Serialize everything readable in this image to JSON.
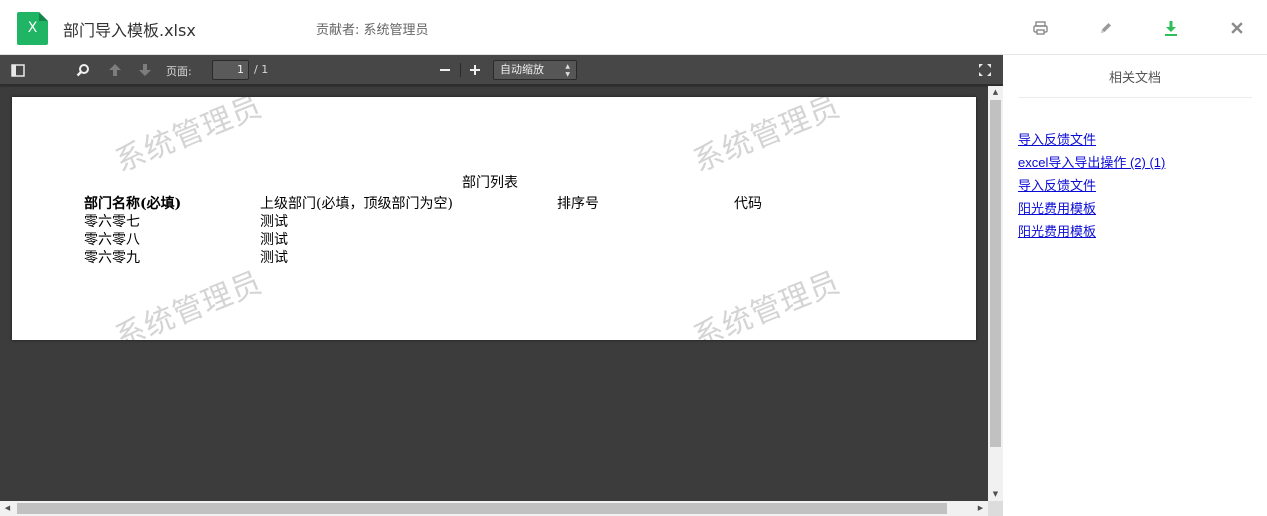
{
  "header": {
    "file_icon_letter": "X",
    "file_name": "部门导入模板.xlsx",
    "contributor": "贡献者: 系统管理员",
    "actions": [
      {
        "name": "print-icon"
      },
      {
        "name": "pencil-icon"
      },
      {
        "name": "download-icon"
      },
      {
        "name": "close-icon"
      }
    ],
    "colors": {
      "file_icon": "#1fb565",
      "download": "#2fbf5a",
      "action_gray": "#8a8a8a"
    }
  },
  "toolbar": {
    "page_label": "页面:",
    "page_current": "1",
    "page_total": "/ 1",
    "zoom_value": "自动缩放",
    "icons": [
      "sidebar-toggle-icon",
      "search-icon",
      "previous-page-icon",
      "next-page-icon",
      "zoom-out-icon",
      "zoom-in-icon",
      "fullscreen-icon"
    ]
  },
  "document": {
    "watermark": "系统管理员",
    "sheet_title": "部门列表",
    "columns": [
      "部门名称(必填)",
      "上级部门(必填，顶级部门为空)",
      "排序号",
      "代码"
    ],
    "rows": [
      [
        "零六零七",
        "测试"
      ],
      [
        "零六零八",
        "测试"
      ],
      [
        "零六零九",
        "测试"
      ]
    ]
  },
  "side_panel": {
    "title": "相关文档",
    "links": [
      "导入反馈文件",
      "excel导入导出操作 (2) (1)",
      "导入反馈文件",
      "阳光费用模板",
      "阳光费用模板"
    ]
  }
}
